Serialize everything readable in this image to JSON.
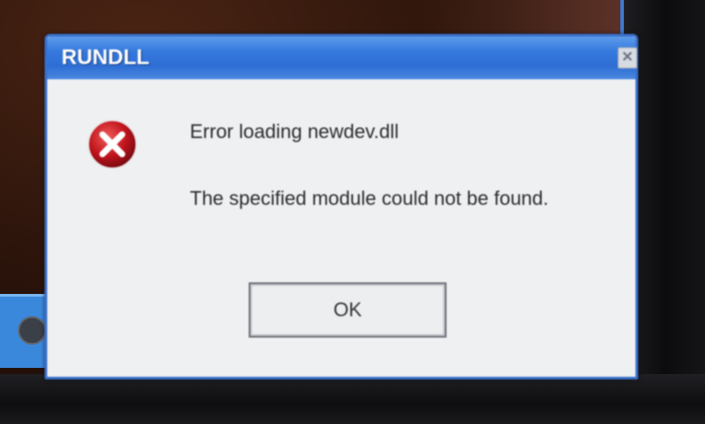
{
  "window": {
    "title": "RUNDLL",
    "close_glyph": "✕"
  },
  "message": {
    "line1": "Error loading newdev.dll",
    "line2": "The specified module could not be found."
  },
  "buttons": {
    "ok_label": "OK"
  },
  "icons": {
    "error": "error-icon",
    "close": "close-icon"
  },
  "colors": {
    "titlebar": "#3578dd",
    "dialog_bg": "#eef0f2",
    "error_red": "#c0141c"
  }
}
